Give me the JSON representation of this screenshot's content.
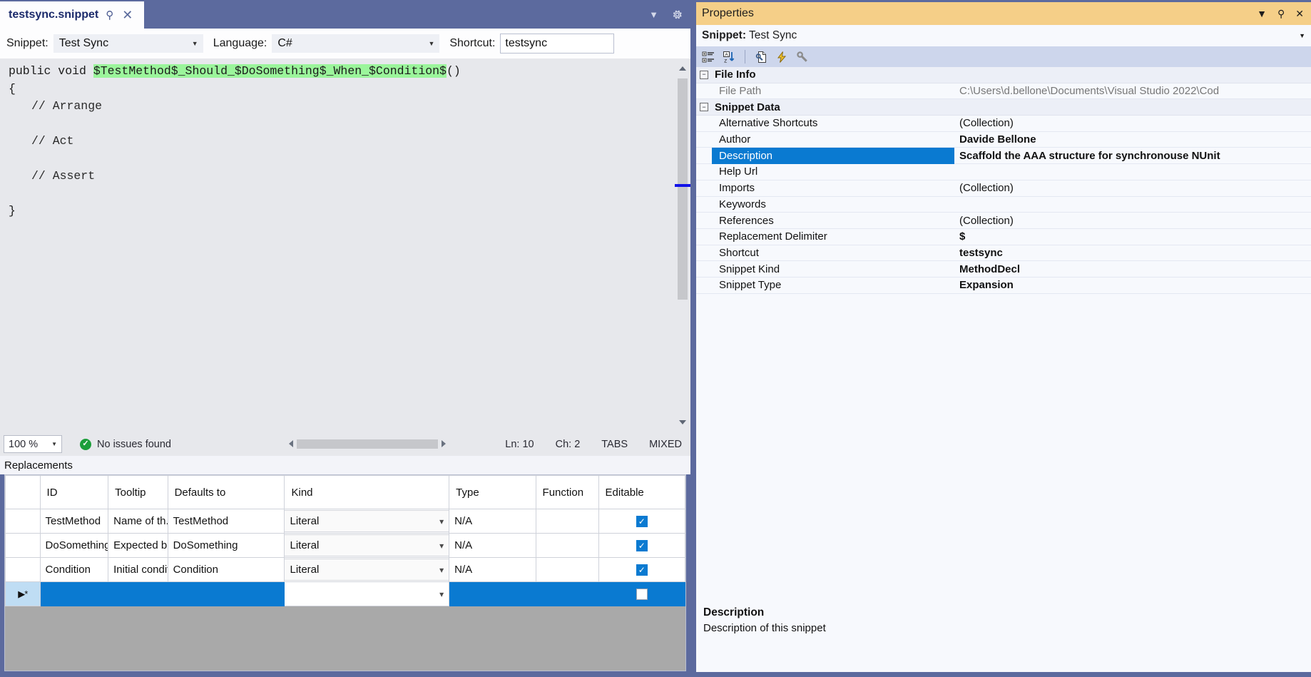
{
  "editor_window": {
    "tab": {
      "title": "testsync.snippet",
      "pin_icon": "pin-icon",
      "close_icon": "close-icon"
    },
    "tabstrip_controls": {
      "dropdown_icon": "chevron-down-icon",
      "settings_icon": "gear-icon"
    },
    "snippet_bar": {
      "snippet_label": "Snippet:",
      "snippet_value": "Test Sync",
      "language_label": "Language:",
      "language_value": "C#",
      "shortcut_label": "Shortcut:",
      "shortcut_value": "testsync"
    },
    "code": {
      "line1_pre": "public void ",
      "line1_t1": "$TestMethod$",
      "line1_s1": "_Should_",
      "line1_t2": "$DoSomething$",
      "line1_s2": "_When_",
      "line1_t3": "$Condition$",
      "line1_post": "()",
      "line2": "{",
      "line3": "// Arrange",
      "line4": "// Act",
      "line5": "// Assert",
      "line6": "}"
    },
    "status_bar": {
      "zoom": "100 %",
      "issues_icon": "check-circle-icon",
      "issues": "No issues found",
      "line": "Ln: 10",
      "char": "Ch: 2",
      "tabs": "TABS",
      "encoding": "MIXED"
    },
    "replacements": {
      "title": "Replacements",
      "columns": [
        "",
        "ID",
        "Tooltip",
        "Defaults to",
        "Kind",
        "Type",
        "Function",
        "Editable"
      ],
      "rows": [
        {
          "marker": "",
          "id": "TestMethod",
          "tooltip": "Name of th...",
          "defaults_to": "TestMethod",
          "kind": "Literal",
          "type": "N/A",
          "function": "",
          "editable": true
        },
        {
          "marker": "",
          "id": "DoSomething",
          "tooltip": "Expected b...",
          "defaults_to": "DoSomething",
          "kind": "Literal",
          "type": "N/A",
          "function": "",
          "editable": true
        },
        {
          "marker": "",
          "id": "Condition",
          "tooltip": "Initial condit...",
          "defaults_to": "Condition",
          "kind": "Literal",
          "type": "N/A",
          "function": "",
          "editable": true
        },
        {
          "marker": "▶*",
          "id": "",
          "tooltip": "",
          "defaults_to": "",
          "kind": "",
          "type": "",
          "function": "",
          "editable": false
        }
      ]
    }
  },
  "properties_window": {
    "title": "Properties",
    "title_controls": {
      "dropdown_icon": "chevron-down-icon",
      "pin_icon": "pin-icon",
      "close_icon": "close-icon"
    },
    "object_label": "Snippet:",
    "object_value": "Test Sync",
    "toolbar_icons": [
      "categorized-icon",
      "alphabetical-icon",
      "properties-page-icon",
      "events-icon",
      "property-pages-icon"
    ],
    "groups": [
      {
        "name": "File Info",
        "expanded": true,
        "rows": [
          {
            "name": "File Path",
            "value": "C:\\Users\\d.bellone\\Documents\\Visual Studio 2022\\Cod",
            "readonly": true,
            "bold": false
          }
        ]
      },
      {
        "name": "Snippet Data",
        "expanded": true,
        "rows": [
          {
            "name": "Alternative Shortcuts",
            "value": "(Collection)",
            "readonly": false,
            "bold": false
          },
          {
            "name": "Author",
            "value": "Davide Bellone",
            "readonly": false,
            "bold": true
          },
          {
            "name": "Description",
            "value": "Scaffold the AAA structure for synchronouse NUnit",
            "readonly": false,
            "bold": true,
            "selected": true
          },
          {
            "name": "Help Url",
            "value": "",
            "readonly": false,
            "bold": false
          },
          {
            "name": "Imports",
            "value": "(Collection)",
            "readonly": false,
            "bold": false
          },
          {
            "name": "Keywords",
            "value": "",
            "readonly": false,
            "bold": false
          },
          {
            "name": "References",
            "value": "(Collection)",
            "readonly": false,
            "bold": false
          },
          {
            "name": "Replacement Delimiter",
            "value": "$",
            "readonly": false,
            "bold": true
          },
          {
            "name": "Shortcut",
            "value": "testsync",
            "readonly": false,
            "bold": true
          },
          {
            "name": "Snippet Kind",
            "value": "MethodDecl",
            "readonly": false,
            "bold": true
          },
          {
            "name": "Snippet Type",
            "value": "Expansion",
            "readonly": false,
            "bold": true
          }
        ]
      }
    ],
    "description_pane": {
      "heading": "Description",
      "text": "Description of this snippet"
    }
  },
  "colors": {
    "window_chrome": "#5c6a9e",
    "title_active": "#f5cf88",
    "selection": "#0a7ad1",
    "replacement_highlight": "#9bf59b",
    "toolbar": "#cdd6ec"
  }
}
